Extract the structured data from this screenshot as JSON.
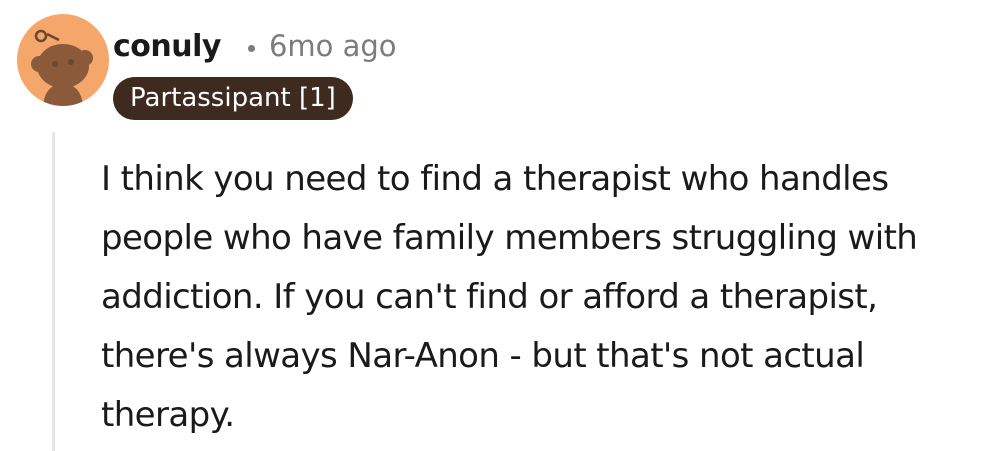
{
  "comment": {
    "author": "conuly",
    "separator": "•",
    "timestamp": "6mo ago",
    "flair": "Partassipant [1]",
    "body": "I think you need to find a therapist who handles people who have family members struggling with addiction. If you can't find or afford a therapist, there's always Nar-Anon - but that's not actual therapy.",
    "avatar_icon": "snoo-avatar-icon"
  },
  "colors": {
    "avatar_bg": "#f5a76b",
    "avatar_face": "#8a5a3b",
    "flair_bg": "#3e2a1f",
    "flair_text": "#ffffff",
    "meta_text": "#7c7c7c",
    "thread_line": "#e6e6e6",
    "body_text": "#1a1a1b"
  }
}
